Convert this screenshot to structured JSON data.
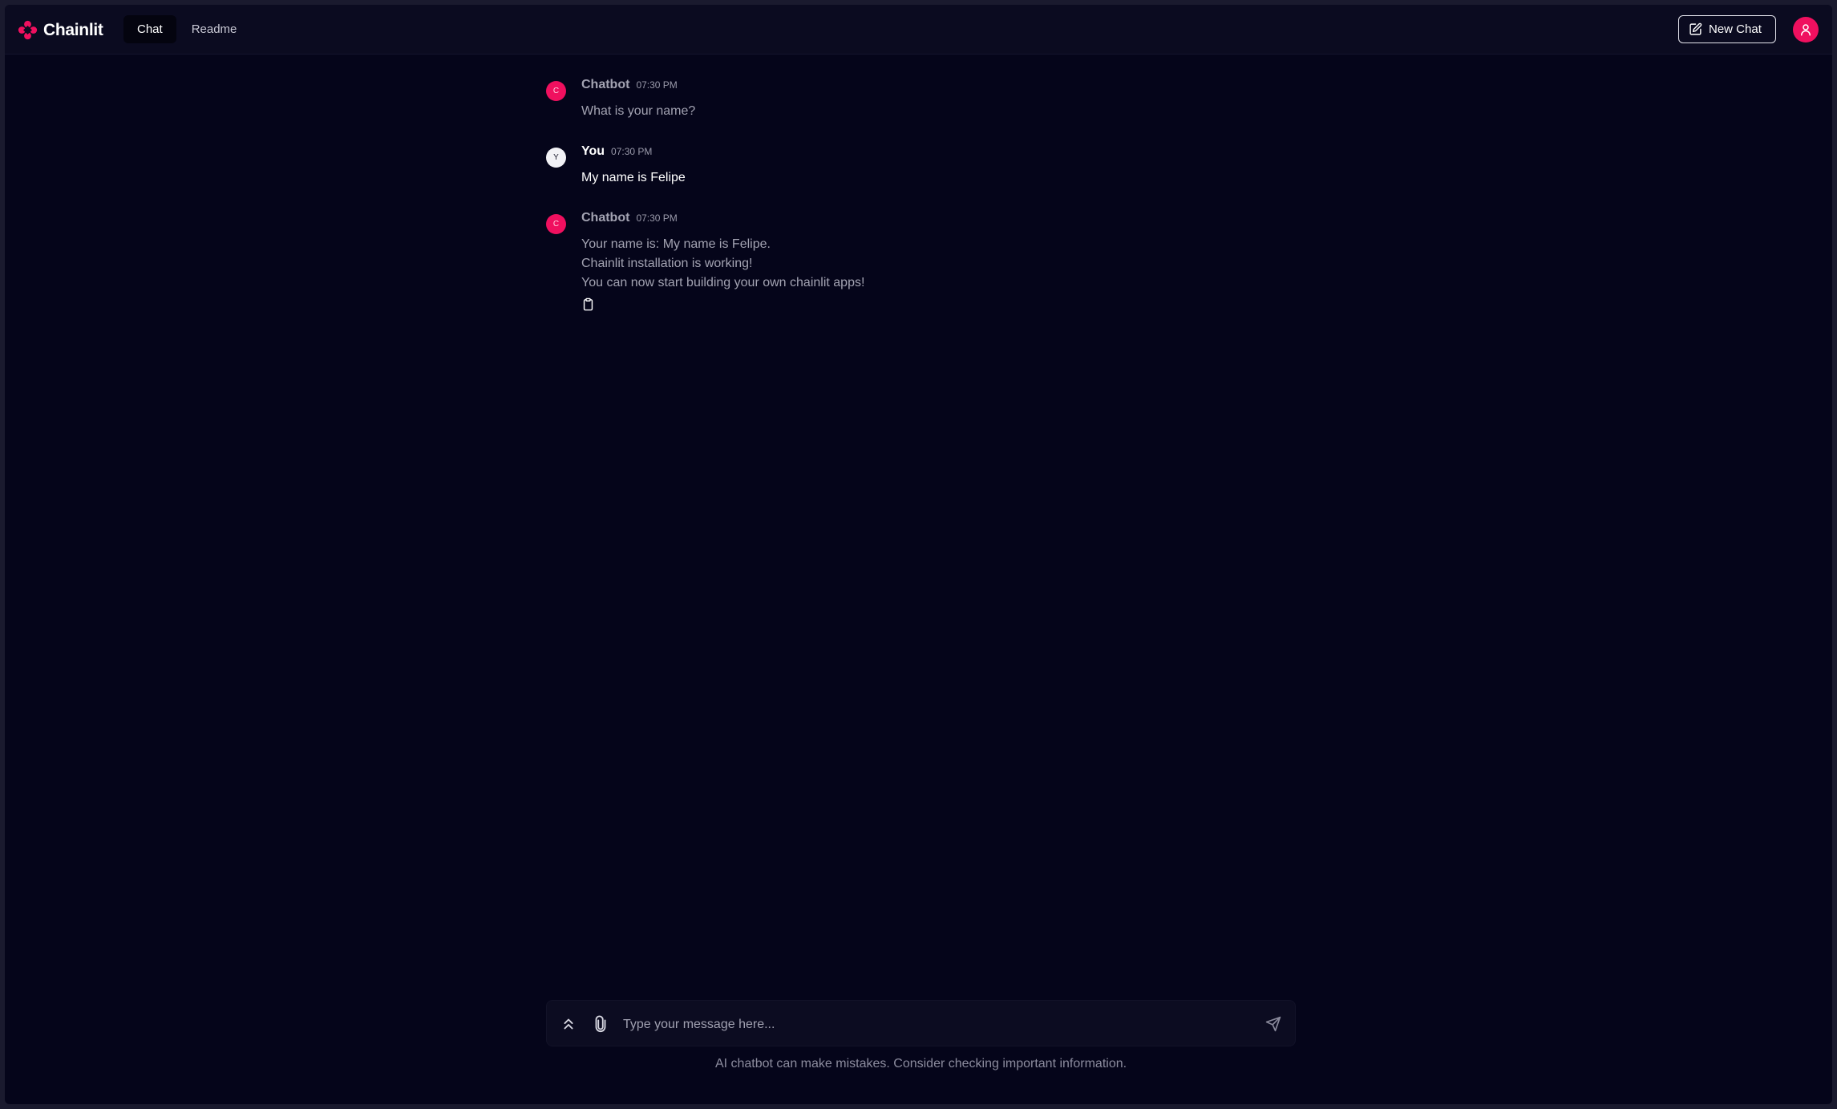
{
  "app": {
    "name": "Chainlit",
    "brand_color": "#f0105f"
  },
  "header": {
    "tabs": [
      {
        "label": "Chat",
        "active": true
      },
      {
        "label": "Readme",
        "active": false
      }
    ],
    "new_chat_label": "New Chat",
    "new_chat_icon": "edit-icon",
    "user_icon": "user-icon"
  },
  "messages": [
    {
      "author": "Chatbot",
      "role": "bot",
      "avatar_letter": "C",
      "time": "07:30 PM",
      "lines": [
        "What is your name?"
      ]
    },
    {
      "author": "You",
      "role": "user",
      "avatar_letter": "Y",
      "time": "07:30 PM",
      "lines": [
        "My name is Felipe"
      ]
    },
    {
      "author": "Chatbot",
      "role": "bot",
      "avatar_letter": "C",
      "time": "07:30 PM",
      "lines": [
        "Your name is: My name is Felipe.",
        "Chainlit installation is working!",
        "You can now start building your own chainlit apps!"
      ],
      "actions": [
        "clipboard-icon"
      ]
    }
  ],
  "composer": {
    "placeholder": "Type your message here...",
    "value": "",
    "icons": [
      "chevrons-up-icon",
      "paperclip-icon",
      "send-icon"
    ]
  },
  "footer": {
    "disclaimer": "AI chatbot can make mistakes. Consider checking important information."
  }
}
